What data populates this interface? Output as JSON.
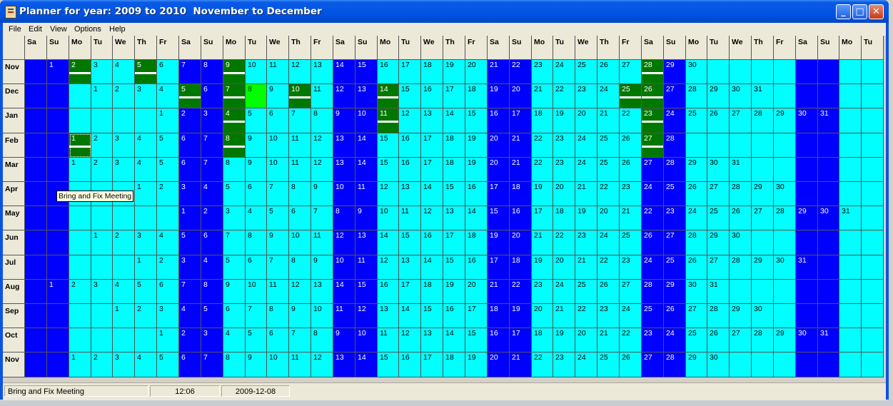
{
  "window": {
    "title": "Planner for year: 2009 to 2010  November to December",
    "minimize": "_",
    "maximize": "□",
    "close": "✕"
  },
  "menu": [
    "File",
    "Edit",
    "View",
    "Options",
    "Help"
  ],
  "grid": {
    "day_headers": [
      "Sa",
      "Su",
      "Mo",
      "Tu",
      "We",
      "Th",
      "Fr",
      "Sa",
      "Su",
      "Mo",
      "Tu",
      "We",
      "Th",
      "Fr",
      "Sa",
      "Su",
      "Mo",
      "Tu",
      "We",
      "Th",
      "Fr",
      "Sa",
      "Su",
      "Mo",
      "Tu",
      "We",
      "Th",
      "Fr",
      "Sa",
      "Su",
      "Mo",
      "Tu",
      "We",
      "Th",
      "Fr",
      "Sa",
      "Su",
      "Mo",
      "Tu"
    ],
    "months": [
      {
        "label": "Nov",
        "offset": 1,
        "days": 30
      },
      {
        "label": "Dec",
        "offset": 3,
        "days": 31
      },
      {
        "label": "Jan",
        "offset": 6,
        "days": 31
      },
      {
        "label": "Feb",
        "offset": 2,
        "days": 28
      },
      {
        "label": "Mar",
        "offset": 2,
        "days": 31
      },
      {
        "label": "Apr",
        "offset": 5,
        "days": 30
      },
      {
        "label": "May",
        "offset": 7,
        "days": 31
      },
      {
        "label": "Jun",
        "offset": 3,
        "days": 30
      },
      {
        "label": "Jul",
        "offset": 5,
        "days": 31
      },
      {
        "label": "Aug",
        "offset": 1,
        "days": 31
      },
      {
        "label": "Sep",
        "offset": 4,
        "days": 30
      },
      {
        "label": "Oct",
        "offset": 6,
        "days": 31
      },
      {
        "label": "Nov",
        "offset": 2,
        "days": 30
      }
    ],
    "events": {
      "0": [
        2,
        5,
        9,
        28
      ],
      "1": [
        5,
        7,
        10,
        14,
        25,
        26
      ],
      "2": [
        4,
        11,
        23
      ],
      "3": [
        1,
        8,
        27
      ]
    },
    "today": {
      "month": 1,
      "day": 8
    },
    "focused": {
      "month": 3,
      "day": 1
    }
  },
  "tooltip": "Bring and Fix Meeting",
  "status": {
    "message": "Bring and Fix Meeting",
    "time": "12:06",
    "date": "2009-12-08"
  },
  "colors": {
    "weekday": "#00ffff",
    "weekend": "#0000ff",
    "event": "#007800",
    "today": "#00ff00"
  }
}
